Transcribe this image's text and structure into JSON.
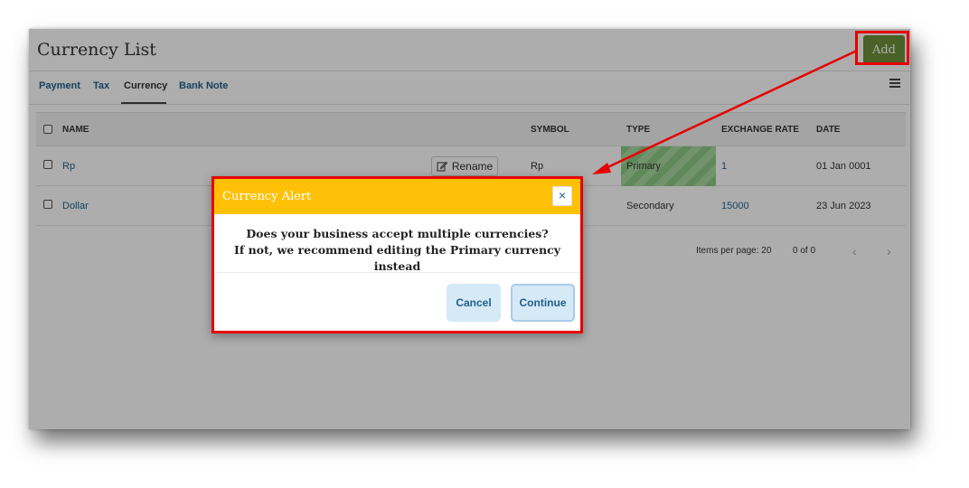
{
  "page": {
    "title": "Currency List"
  },
  "header": {
    "add_label": "Add"
  },
  "tabs": [
    {
      "label": "Payment"
    },
    {
      "label": "Tax"
    },
    {
      "label": "Currency",
      "active": true
    },
    {
      "label": "Bank Note"
    }
  ],
  "table": {
    "headers": [
      "NAME",
      "SYMBOL",
      "TYPE",
      "EXCHANGE RATE",
      "DATE"
    ],
    "rows": [
      {
        "name": "Rp",
        "symbol": "Rp",
        "type": "Primary",
        "rate": "1",
        "date": "01 Jan 0001",
        "action": "Rename"
      },
      {
        "name": "Dollar",
        "symbol": "",
        "type": "Secondary",
        "rate": "15000",
        "date": "23 Jun 2023"
      }
    ]
  },
  "pagination": {
    "items_per_page": "Items per page: 20",
    "range": "0 of 0",
    "prev": "‹",
    "next": "›"
  },
  "dialog": {
    "title": "Currency Alert",
    "close": "×",
    "message_line1": "Does your business accept multiple currencies?",
    "message_line2": "If not, we recommend editing the Primary currency instead",
    "cancel_label": "Cancel",
    "continue_label": "Continue"
  },
  "icons": {
    "menu": "hamburger-icon",
    "rename": "edit-icon",
    "close": "close-icon"
  },
  "colors": {
    "accent": "#1f5f8b",
    "add_button": "#6d8f3a",
    "dialog_header": "#ffc107",
    "highlight": "#e60000",
    "primary_type": "#8fc986"
  }
}
